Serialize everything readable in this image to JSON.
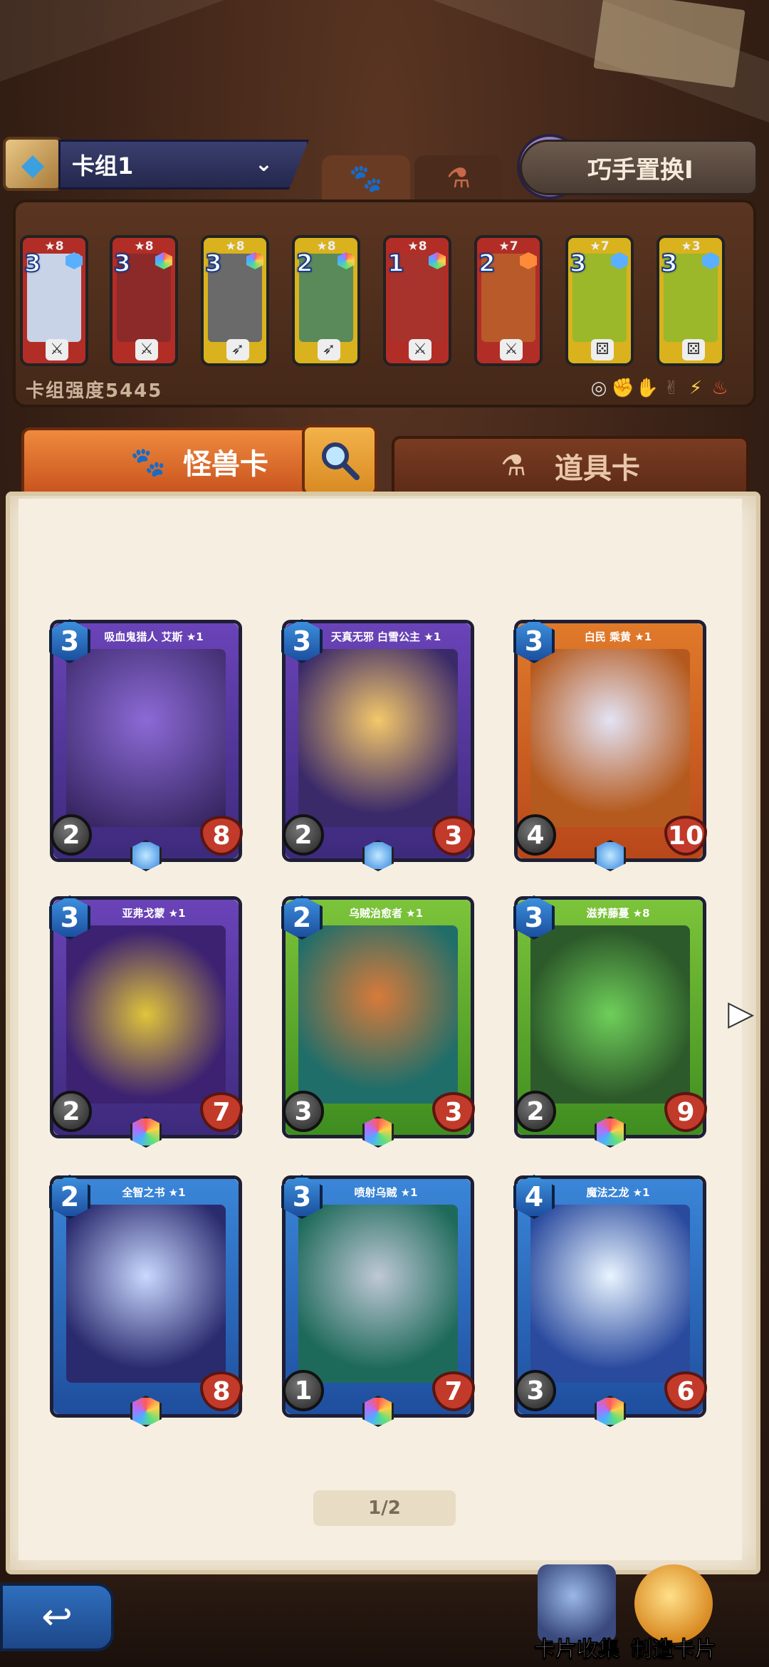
{
  "header": {
    "deck_name": "卡组1",
    "swap_label": "巧手置换I"
  },
  "deck": {
    "power_label": "卡组强度5445",
    "cards": [
      {
        "cost": "3",
        "stars": "★8",
        "color": "red"
      },
      {
        "cost": "3",
        "stars": "★8",
        "color": "red"
      },
      {
        "cost": "3",
        "stars": "★8",
        "color": "yellow"
      },
      {
        "cost": "2",
        "stars": "★8",
        "color": "yellow"
      },
      {
        "cost": "1",
        "stars": "★8",
        "color": "red"
      },
      {
        "cost": "2",
        "stars": "★7",
        "color": "red"
      },
      {
        "cost": "3",
        "stars": "★7",
        "color": "yellow"
      },
      {
        "cost": "3",
        "stars": "★3",
        "color": "yellow"
      }
    ]
  },
  "tabs": {
    "monster_label": "怪兽卡",
    "item_label": "道具卡"
  },
  "cards": [
    {
      "name": "吸血鬼猎人 艾斯 ★1",
      "cost": "3",
      "atk": "2",
      "hp": "8"
    },
    {
      "name": "天真无邪 白雪公主 ★1",
      "cost": "3",
      "atk": "2",
      "hp": "3"
    },
    {
      "name": "白民 乘黄 ★1",
      "cost": "3",
      "atk": "4",
      "hp": "10"
    },
    {
      "name": "亚弗戈蒙 ★1",
      "cost": "3",
      "atk": "2",
      "hp": "7"
    },
    {
      "name": "乌贼治愈者 ★1",
      "cost": "2",
      "atk": "3",
      "hp": "3"
    },
    {
      "name": "滋养藤蔓 ★8",
      "cost": "3",
      "atk": "2",
      "hp": "9"
    },
    {
      "name": "全智之书 ★1",
      "cost": "2",
      "atk": "",
      "hp": "8"
    },
    {
      "name": "喷射乌贼 ★1",
      "cost": "3",
      "atk": "1",
      "hp": "7"
    },
    {
      "name": "魔法之龙 ★1",
      "cost": "4",
      "atk": "3",
      "hp": "6"
    }
  ],
  "pager": {
    "label": "1/2"
  },
  "bottom": {
    "collection_label": "卡片收集",
    "craft_label": "制造卡片"
  }
}
